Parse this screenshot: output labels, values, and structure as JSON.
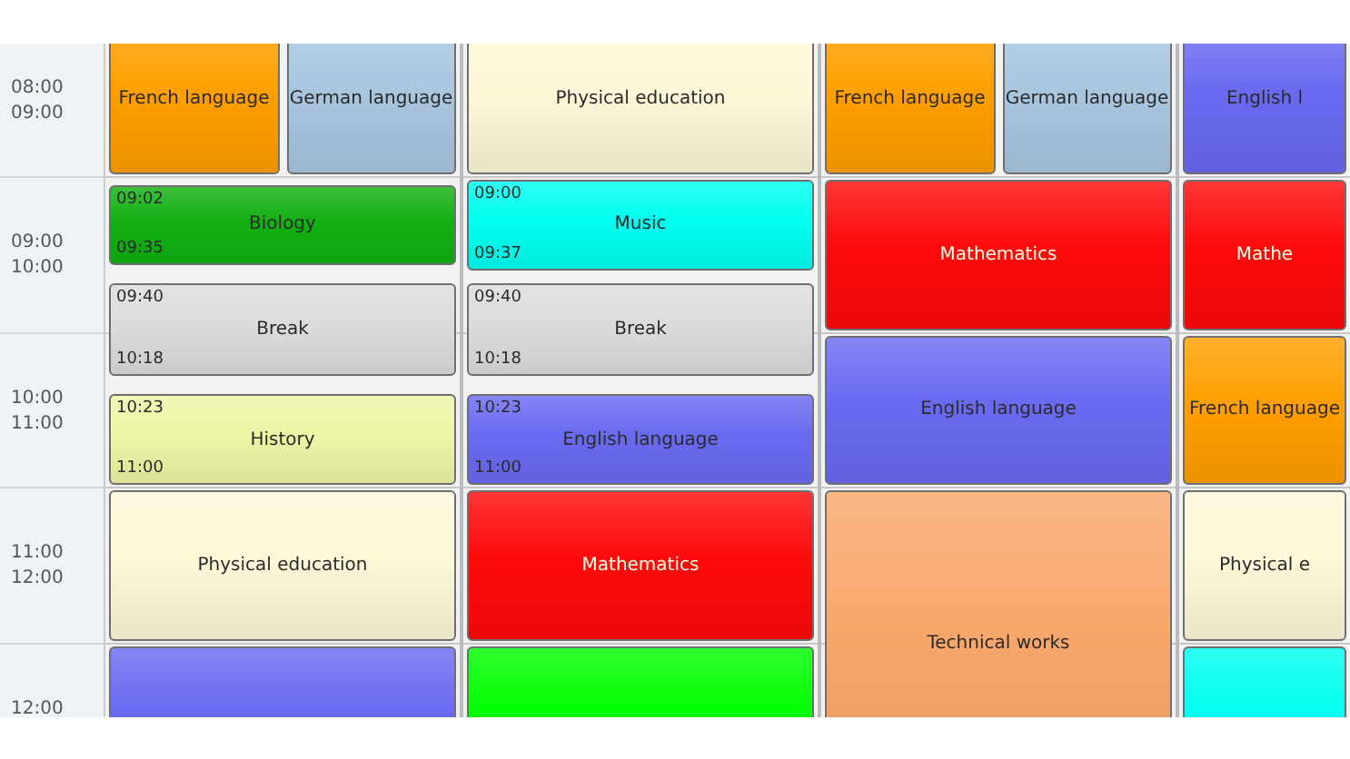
{
  "time_slots": [
    {
      "start": "08:00",
      "end": "09:00"
    },
    {
      "start": "09:00",
      "end": "10:00"
    },
    {
      "start": "10:00",
      "end": "11:00"
    },
    {
      "start": "11:00",
      "end": "12:00"
    },
    {
      "start": "12:00"
    }
  ],
  "days": [
    {
      "events": [
        {
          "title": "French language",
          "color": "#ff9f00"
        },
        {
          "title": "German language",
          "color": "#a9c6df"
        },
        {
          "title": "Biology",
          "start": "09:02",
          "end": "09:35",
          "color": "#12b012"
        },
        {
          "title": "Break",
          "start": "09:40",
          "end": "10:18",
          "color": "#dcdcdc"
        },
        {
          "title": "History",
          "start": "10:23",
          "end": "11:00",
          "color": "#eef5a6"
        },
        {
          "title": "Physical education",
          "color": "#fdf8d8"
        },
        {
          "color": "#6a6af2"
        }
      ]
    },
    {
      "events": [
        {
          "title": "Physical education",
          "color": "#fdf8d8"
        },
        {
          "title": "Music",
          "start": "09:00",
          "end": "09:37",
          "color": "#00fff0"
        },
        {
          "title": "Break",
          "start": "09:40",
          "end": "10:18",
          "color": "#dcdcdc"
        },
        {
          "title": "English language",
          "start": "10:23",
          "end": "11:00",
          "color": "#6a6af2"
        },
        {
          "title": "Mathematics",
          "color": "#ff0a0a"
        },
        {
          "color": "#00ff00"
        }
      ]
    },
    {
      "events": [
        {
          "title": "French language",
          "color": "#ff9f00"
        },
        {
          "title": "German language",
          "color": "#a9c6df"
        },
        {
          "title": "Mathematics",
          "color": "#ff0a0a"
        },
        {
          "title": "English language",
          "color": "#6a6af2"
        },
        {
          "title": "Technical works",
          "color": "#f9a76b"
        }
      ]
    },
    {
      "events": [
        {
          "title": "English l",
          "color": "#6a6af2"
        },
        {
          "title": "Mathe",
          "color": "#ff0a0a"
        },
        {
          "title": "French language",
          "color": "#ff9f00"
        },
        {
          "title": "Physical e",
          "color": "#fdf8d8"
        },
        {
          "color": "#00fff0"
        }
      ]
    }
  ]
}
